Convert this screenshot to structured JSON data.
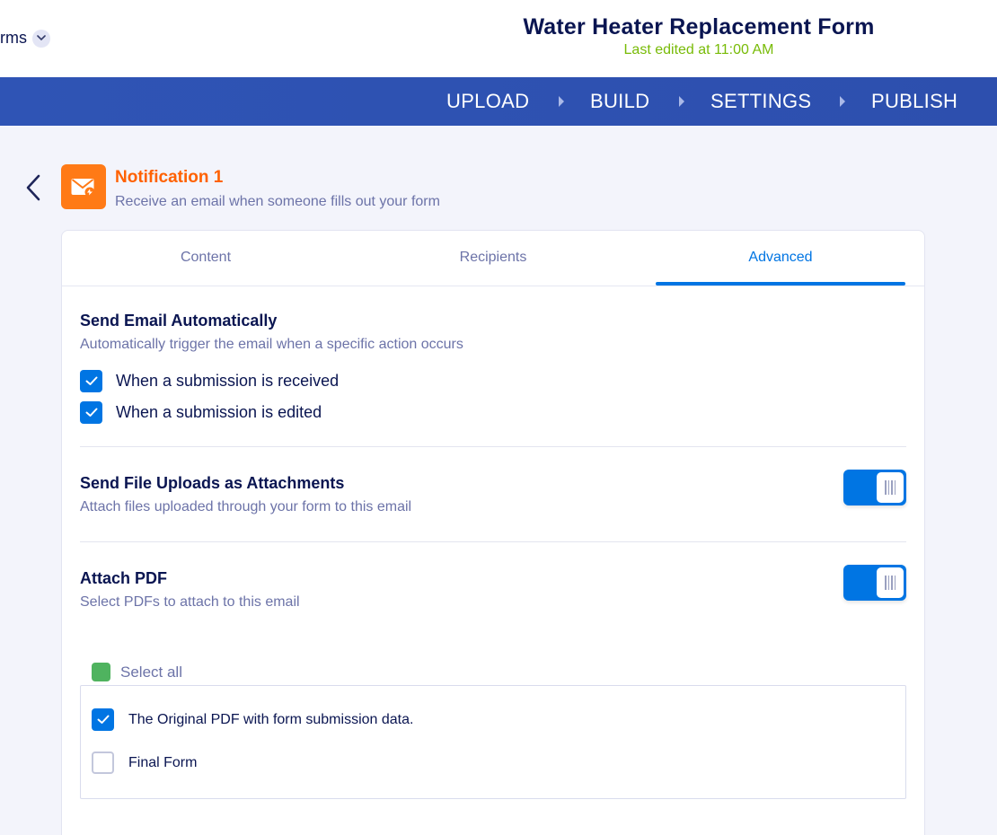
{
  "header": {
    "breadcrumb": "rms",
    "form_title": "Water Heater Replacement Form",
    "last_edited": "Last edited at 11:00 AM"
  },
  "nav": {
    "steps": [
      "UPLOAD",
      "BUILD",
      "SETTINGS",
      "PUBLISH"
    ],
    "active": "SETTINGS"
  },
  "notification": {
    "title": "Notification 1",
    "description": "Receive an email when someone fills out your form"
  },
  "tabs": {
    "items": [
      "Content",
      "Recipients",
      "Advanced"
    ],
    "active": "Advanced"
  },
  "send_auto": {
    "title": "Send Email Automatically",
    "description": "Automatically trigger the email when a specific action occurs",
    "options": [
      {
        "label": "When a submission is received",
        "checked": true
      },
      {
        "label": "When a submission is edited",
        "checked": true
      }
    ]
  },
  "file_uploads": {
    "title": "Send File Uploads as Attachments",
    "description": "Attach files uploaded through your form to this email",
    "enabled": true
  },
  "attach_pdf": {
    "title": "Attach PDF",
    "description": "Select PDFs to attach to this email",
    "enabled": true,
    "select_all_label": "Select all",
    "pdfs": [
      {
        "label": "The Original PDF with form submission data.",
        "checked": true
      },
      {
        "label": "Final Form",
        "checked": false
      }
    ]
  },
  "colors": {
    "accent": "#0075e3",
    "nav": "#2f54b5",
    "orange": "#ff7a16",
    "green": "#78bb07"
  }
}
